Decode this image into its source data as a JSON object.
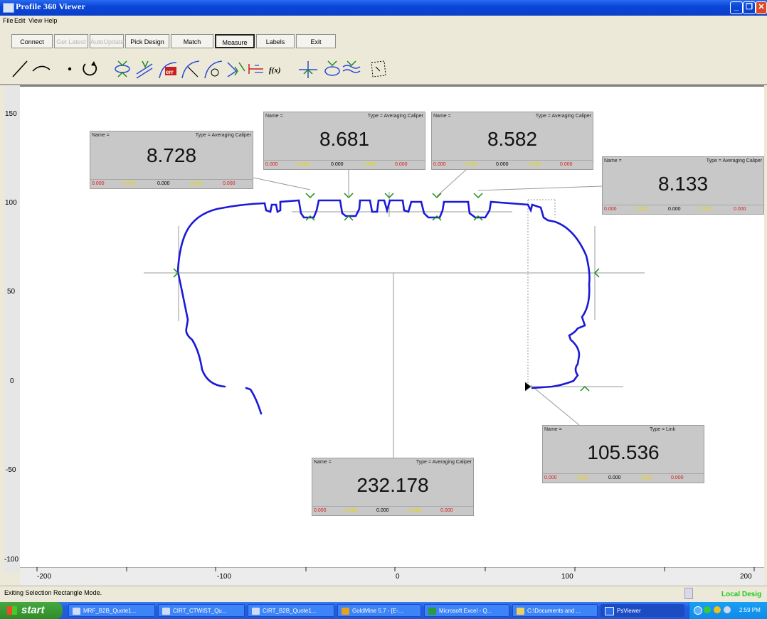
{
  "window": {
    "title": "Profile 360 Viewer"
  },
  "menu": [
    "File",
    "Edit",
    "View",
    "Help"
  ],
  "commands": {
    "connect": "Connect",
    "get_latest": "Get Latest",
    "auto_update": "AutoUpdate",
    "pick_design": "Pick Design",
    "match": "Match",
    "measure": "Measure",
    "labels": "Labels",
    "exit": "Exit"
  },
  "tools": [
    "line-icon",
    "arc-icon",
    "point-icon",
    "rotate-icon",
    "caliper-icon",
    "parallel-icon",
    "error-icon",
    "radius-icon",
    "pgm-radius-icon",
    "angle-icon",
    "link-icon",
    "function-icon",
    "cross-icon",
    "center-icon",
    "wave-icon",
    "select-rect-icon"
  ],
  "function_tool_label": "f(x)",
  "error_tool_label": "err",
  "axes": {
    "y_ticks": [
      "150",
      "100",
      "50",
      "0",
      "-50",
      "-100"
    ],
    "x_ticks": [
      "-200",
      "-100",
      "0",
      "100",
      "200"
    ]
  },
  "measurements": [
    {
      "id": "m1",
      "name": "Name =",
      "type": "Type = Averaging Caliper",
      "value": "8.728",
      "footer": [
        "0.000",
        "0.000",
        "0.000",
        "0.000",
        "0.000"
      ]
    },
    {
      "id": "m2",
      "name": "Name =",
      "type": "Type = Averaging Caliper",
      "value": "8.681",
      "footer": [
        "0.000",
        "0.000",
        "0.000",
        "0.000",
        "0.000"
      ]
    },
    {
      "id": "m3",
      "name": "Name =",
      "type": "Type = Averaging Caliper",
      "value": "8.582",
      "footer": [
        "0.000",
        "0.000",
        "0.000",
        "0.000",
        "0.000"
      ]
    },
    {
      "id": "m4",
      "name": "Name =",
      "type": "Type = Averaging Caliper",
      "value": "8.133",
      "footer": [
        "0.000",
        "0.000",
        "0.000",
        "0.000",
        "0.000"
      ]
    },
    {
      "id": "m5",
      "name": "Name =",
      "type": "Type = Link",
      "value": "105.536",
      "footer": [
        "0.000",
        "0.000",
        "0.000",
        "0.000",
        "0.000"
      ]
    },
    {
      "id": "m6",
      "name": "Name =",
      "type": "Type = Averaging Caliper",
      "value": "232.178",
      "footer": [
        "0.000",
        "0.000",
        "0.000",
        "0.000",
        "0.000"
      ]
    }
  ],
  "colors": {
    "profile": "#1a1ad8",
    "marker": "#1a8a1a",
    "box": "#c8c8c8",
    "footer_red": "#d42020",
    "footer_yellow": "#e6d800"
  },
  "status": {
    "message": "Exiting Selection Rectangle Mode.",
    "right": "Local Desig"
  },
  "taskbar": {
    "start": "start",
    "tasks": [
      "MRF_B2B_Quote1...",
      "CIRT_CTWIST_Qu...",
      "CIRT_B2B_Quote1...",
      "GoldMine 5.7 - [E-...",
      "Microsoft Excel - Q...",
      "C:\\Documents and ...",
      "PsViewer"
    ],
    "clock": "2:59 PM"
  }
}
